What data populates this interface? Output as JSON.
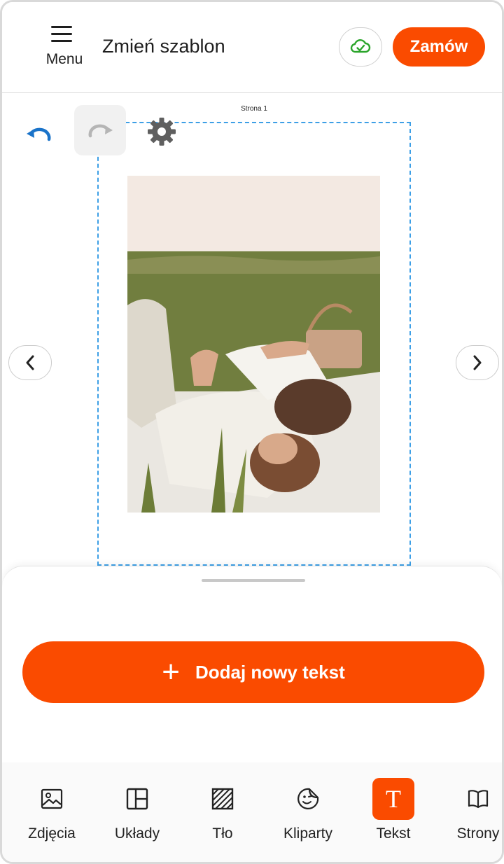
{
  "header": {
    "menu_label": "Menu",
    "title": "Zmień szablon",
    "order_label": "Zamów"
  },
  "canvas": {
    "page_label": "Strona 1"
  },
  "sheet": {
    "add_text_label": "Dodaj nowy tekst"
  },
  "tabs": [
    {
      "label": "Zdjęcia",
      "icon": "image-icon"
    },
    {
      "label": "Układy",
      "icon": "layout-icon"
    },
    {
      "label": "Tło",
      "icon": "background-icon"
    },
    {
      "label": "Kliparty",
      "icon": "sticker-icon"
    },
    {
      "label": "Tekst",
      "icon": "text-icon",
      "active": true
    },
    {
      "label": "Strony",
      "icon": "book-icon"
    }
  ],
  "colors": {
    "accent": "#fa4b00",
    "undo": "#1a73c9",
    "cloud_check": "#2ba52b",
    "dashed_border": "#3d9fe6"
  }
}
